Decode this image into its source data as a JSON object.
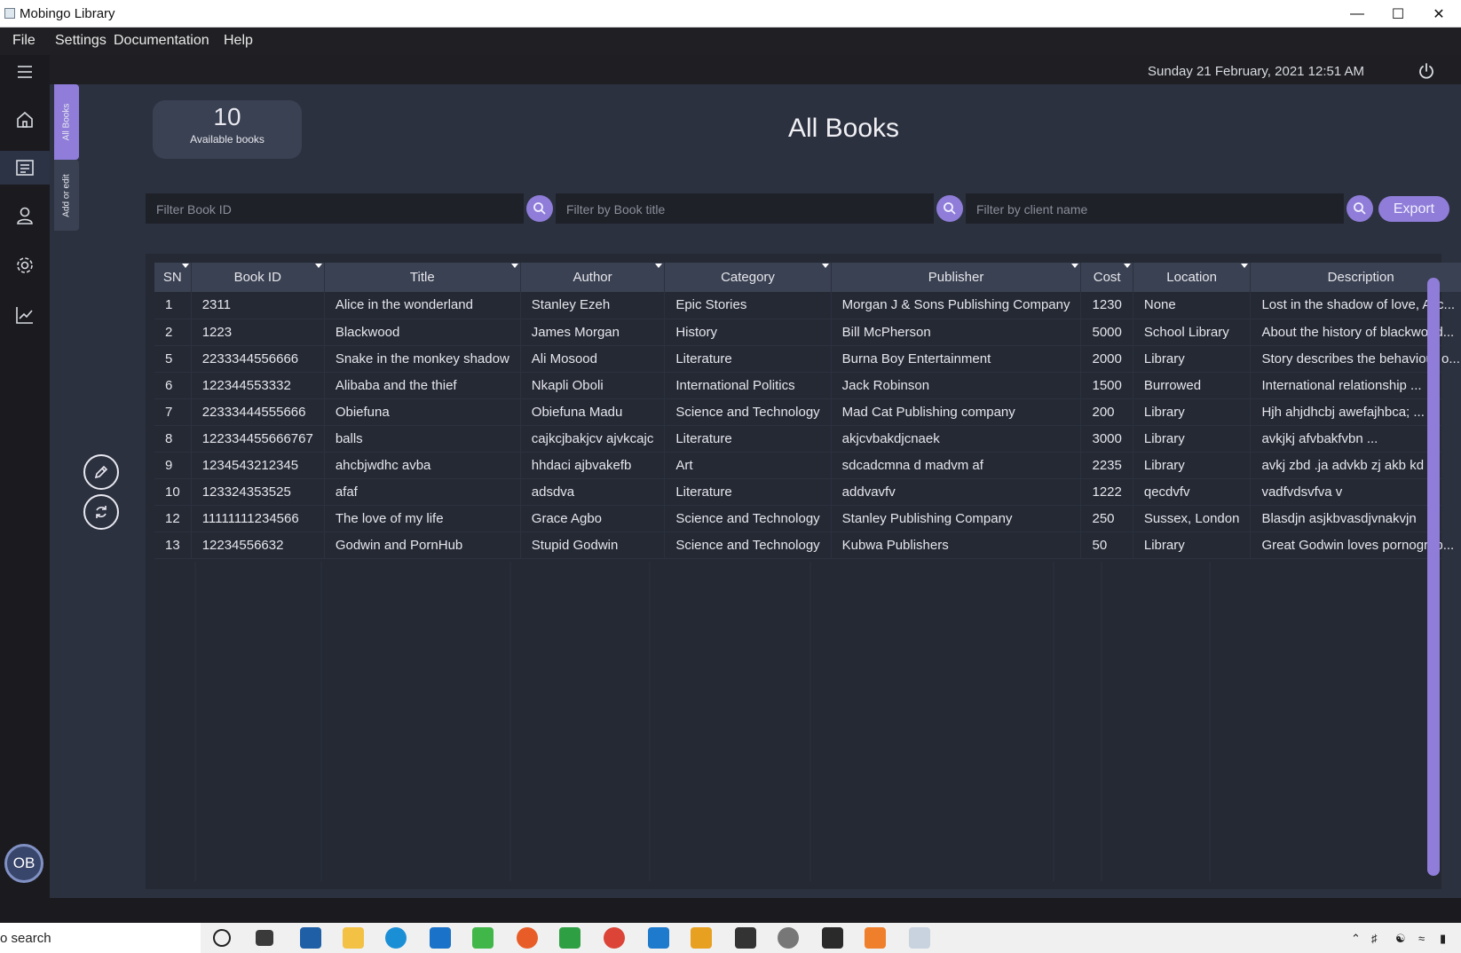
{
  "window": {
    "title": "Mobingo Library"
  },
  "menu": {
    "items": [
      "File",
      "Settings",
      "Documentation",
      "Help"
    ]
  },
  "header": {
    "datetime": "Sunday 21 February, 2021 12:51 AM"
  },
  "sidebar": {
    "avatar_initials": "OB"
  },
  "tabs": {
    "all_books": "All Books",
    "add_edit": "Add or edit"
  },
  "summary": {
    "count": "10",
    "label": "Available books"
  },
  "page": {
    "title": "All Books"
  },
  "filters": {
    "book_id_placeholder": "Filter Book ID",
    "title_placeholder": "Filter by Book title",
    "client_placeholder": "Filter by client name",
    "export_label": "Export"
  },
  "table": {
    "columns": [
      "SN",
      "Book ID",
      "Title",
      "Author",
      "Category",
      "Publisher",
      "Cost",
      "Location",
      "Description"
    ],
    "rows": [
      [
        "1",
        "2311",
        "Alice in the wonderland",
        "Stanley Ezeh",
        "Epic Stories",
        "Morgan J & Sons Publishing Company",
        "1230",
        "None",
        "Lost in the shadow of love, Alic..."
      ],
      [
        "2",
        "1223",
        "Blackwood",
        "James Morgan",
        "History",
        "Bill McPherson",
        "5000",
        "School Library",
        "About the history of blackwood..."
      ],
      [
        "5",
        "2233344556666",
        "Snake in the monkey shadow",
        "Ali Mosood",
        "Literature",
        "Burna Boy Entertainment",
        "2000",
        "Library",
        "Story describes the behaviour o..."
      ],
      [
        "6",
        "122344553332",
        "Alibaba and the thief",
        "Nkapli Oboli",
        "International Politics",
        "Jack Robinson",
        "1500",
        "Burrowed",
        "International relationship ..."
      ],
      [
        "7",
        "22333444555666",
        "Obiefuna",
        "Obiefuna Madu",
        "Science and Technology",
        "Mad Cat Publishing company",
        "200",
        "Library",
        "Hjh ahjdhcbj awefajhbca; ..."
      ],
      [
        "8",
        "122334455666767",
        "balls",
        "cajkcjbakjcv ajvkcajc",
        "Literature",
        "akjcvbakdjcnaek",
        "3000",
        "Library",
        "avkjkj afvbakfvbn ..."
      ],
      [
        "9",
        "1234543212345",
        "ahcbjwdhc avba",
        "hhdaci ajbvakefb",
        "Art",
        "sdcadcmna d madvm af",
        "2235",
        "Library",
        "avkj zbd .ja advkb zj  akb kd ..."
      ],
      [
        "10",
        "123324353525",
        "afaf",
        "adsdva",
        "Literature",
        "addvavfv",
        "1222",
        "qecdvfv",
        "vadfvdsvfva v"
      ],
      [
        "12",
        "11111111234566",
        "The love of my life",
        "Grace Agbo",
        "Science and Technology",
        "Stanley Publishing Company",
        "250",
        "Sussex, London",
        "Blasdjn asjkbvasdjvnakvjn"
      ],
      [
        "13",
        "12234556632",
        "Godwin and PornHub",
        "Stupid Godwin",
        "Science and Technology",
        "Kubwa Publishers",
        "50",
        "Library",
        "Great Godwin loves pornograp..."
      ]
    ]
  },
  "taskbar": {
    "search_text": "o search"
  },
  "colors": {
    "accent": "#8f7dd9",
    "panel": "#2c3140",
    "header_cell": "#3a4152",
    "table_bg": "#252934",
    "sidebar": "#1b1b1f"
  },
  "icons": [
    "menu-icon",
    "power-icon",
    "home-icon",
    "books-icon",
    "user-icon",
    "gear-icon",
    "chart-icon",
    "search-icon",
    "edit-icon",
    "refresh-icon"
  ]
}
